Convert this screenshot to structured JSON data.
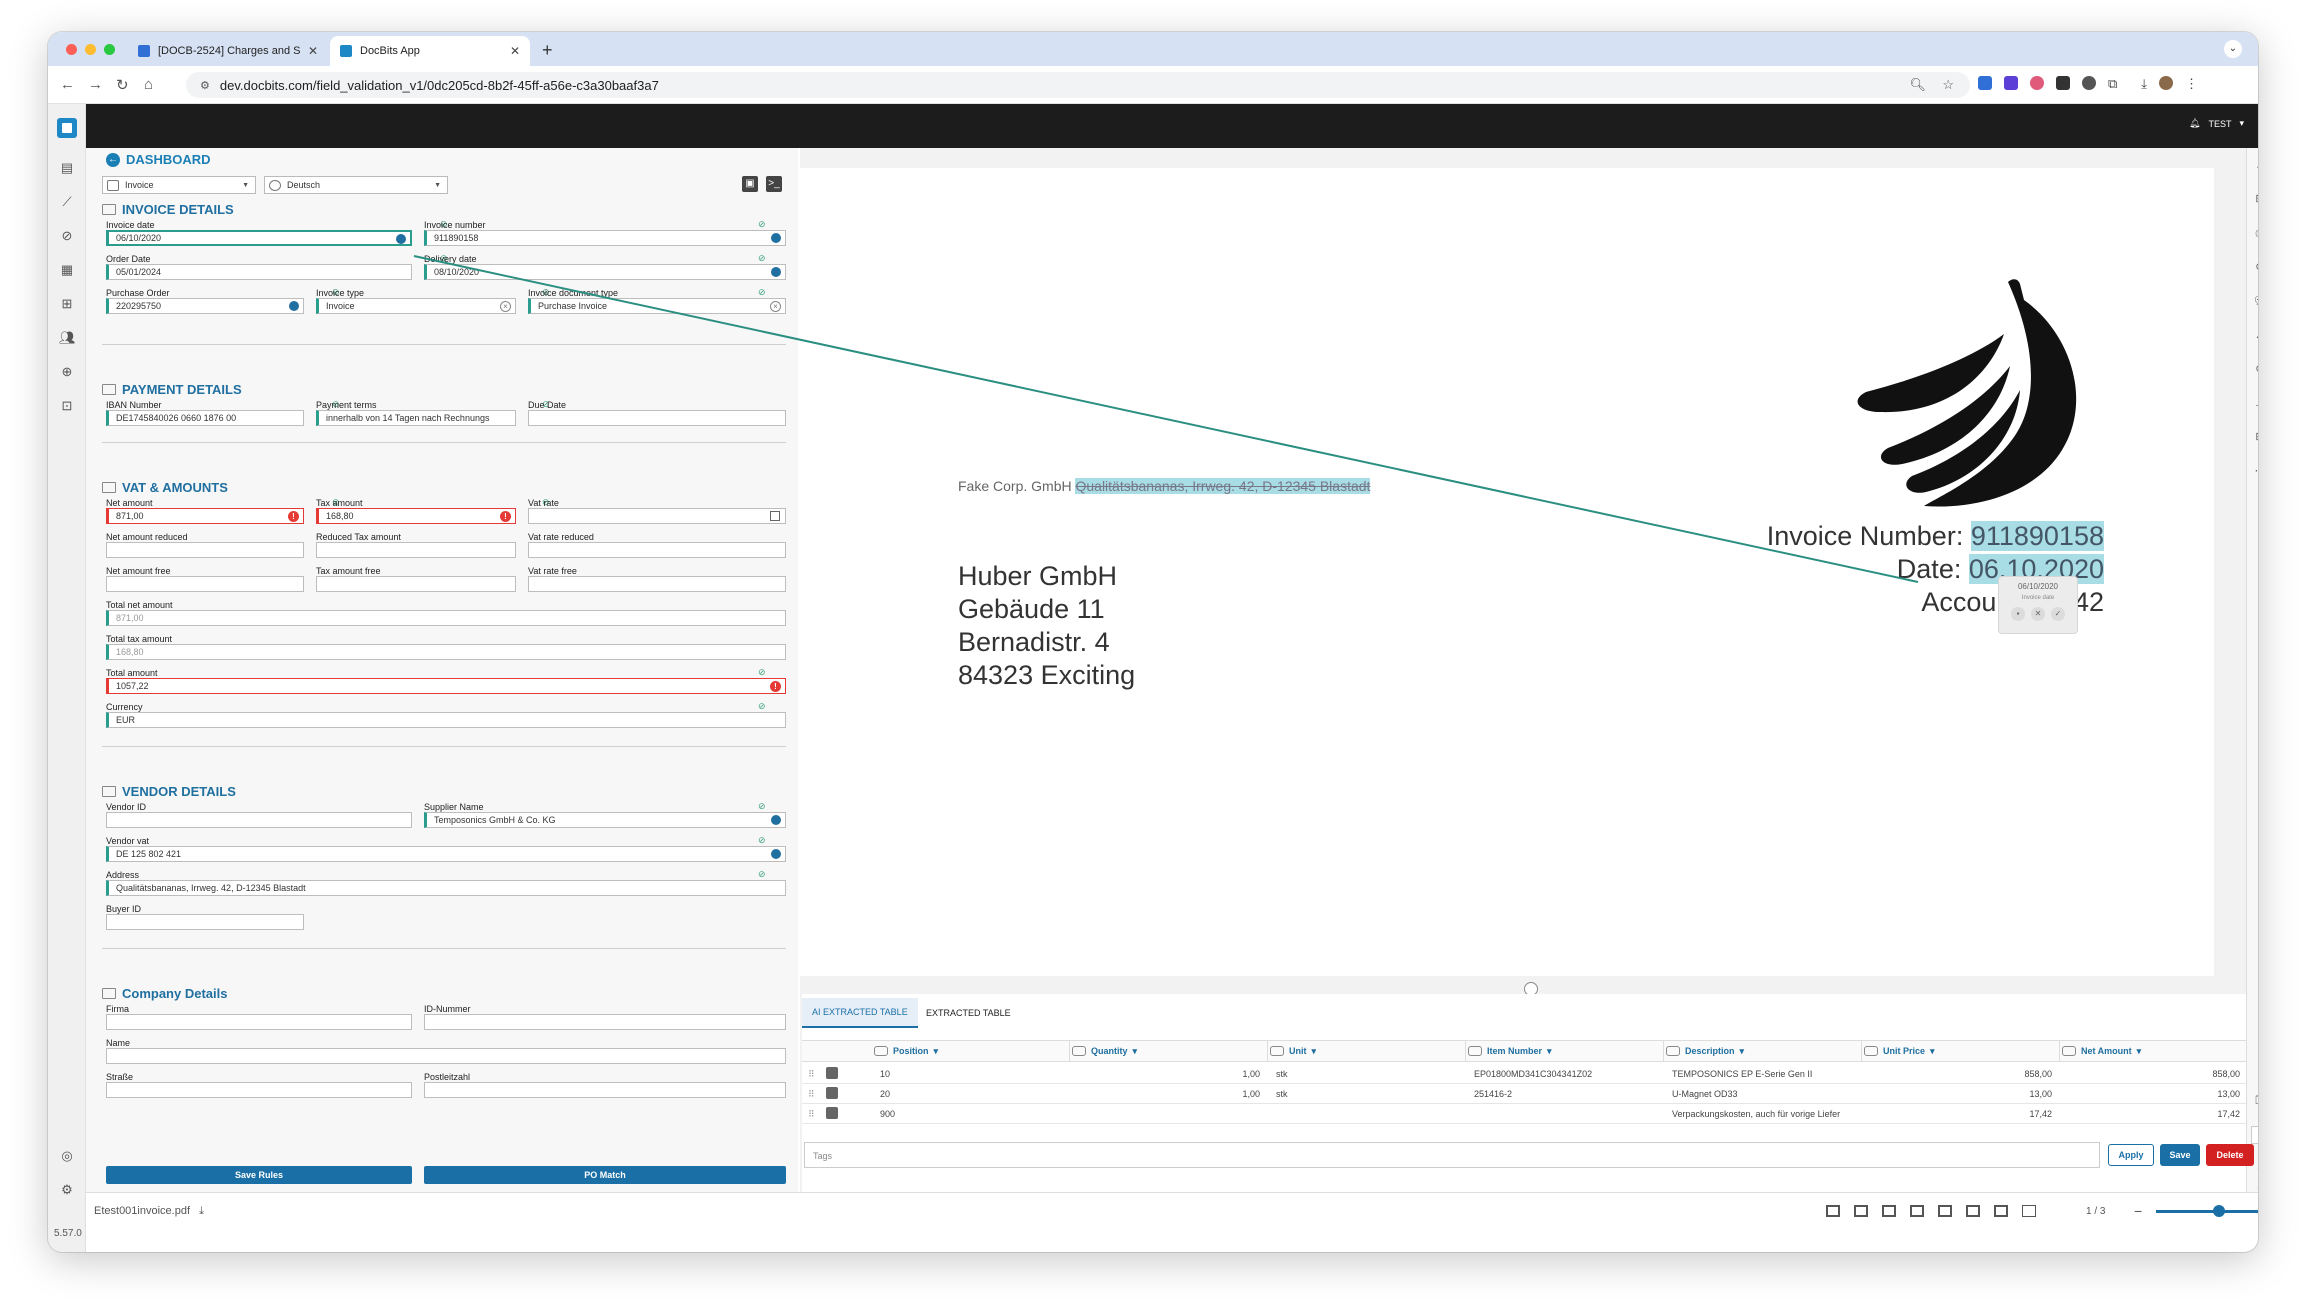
{
  "browser": {
    "tabs": [
      {
        "title": "[DOCB-2524] Charges and S",
        "close": "✕"
      },
      {
        "title": "DocBits App",
        "close": "✕"
      }
    ],
    "new_tab": "+",
    "url": "dev.docbits.com/field_validation_v1/0dc205cd-8b2f-45ff-a56e-c3a30baaf3a7"
  },
  "app": {
    "user": "TEST",
    "dashboard": "DASHBOARD",
    "doc_type": "Invoice",
    "language": "Deutsch",
    "version": "5.57.0"
  },
  "invoice_details": {
    "title": "INVOICE DETAILS",
    "invoice_date": {
      "label": "Invoice date",
      "value": "06/10/2020"
    },
    "invoice_number": {
      "label": "Invoice number",
      "value": "911890158"
    },
    "order_date": {
      "label": "Order Date",
      "value": "05/01/2024"
    },
    "delivery_date": {
      "label": "Delivery date",
      "value": "08/10/2020"
    },
    "purchase_order": {
      "label": "Purchase Order",
      "value": "220295750"
    },
    "invoice_type": {
      "label": "Invoice type",
      "value": "Invoice"
    },
    "invoice_document_type": {
      "label": "Invoice document type",
      "value": "Purchase Invoice"
    }
  },
  "payment_details": {
    "title": "PAYMENT DETAILS",
    "iban": {
      "label": "IBAN Number",
      "value": "DE1745840026 0660 1876 00"
    },
    "payment_terms": {
      "label": "Payment terms",
      "value": "innerhalb von 14 Tagen nach Rechnungs"
    },
    "due_date": {
      "label": "Due Date",
      "value": ""
    }
  },
  "vat_amounts": {
    "title": "VAT & AMOUNTS",
    "net_amount": {
      "label": "Net amount",
      "value": "871,00"
    },
    "tax_amount": {
      "label": "Tax amount",
      "value": "168,80"
    },
    "vat_rate": {
      "label": "Vat rate",
      "value": ""
    },
    "net_amount_reduced": {
      "label": "Net amount reduced",
      "value": ""
    },
    "reduced_tax_amount": {
      "label": "Reduced Tax amount",
      "value": ""
    },
    "vat_rate_reduced": {
      "label": "Vat rate reduced",
      "value": ""
    },
    "net_amount_free": {
      "label": "Net amount free",
      "value": ""
    },
    "tax_amount_free": {
      "label": "Tax amount free",
      "value": ""
    },
    "vat_rate_free": {
      "label": "Vat rate free",
      "value": ""
    },
    "total_net_amount": {
      "label": "Total net amount",
      "value": "871,00"
    },
    "total_tax_amount": {
      "label": "Total tax amount",
      "value": "168,80"
    },
    "total_amount": {
      "label": "Total amount",
      "value": "1057,22"
    },
    "currency": {
      "label": "Currency",
      "value": "EUR"
    }
  },
  "vendor_details": {
    "title": "VENDOR DETAILS",
    "vendor_id": {
      "label": "Vendor ID",
      "value": ""
    },
    "supplier_name": {
      "label": "Supplier Name",
      "value": "Temposonics GmbH & Co. KG"
    },
    "vendor_vat": {
      "label": "Vendor vat",
      "value": "DE 125 802 421"
    },
    "address": {
      "label": "Address",
      "value": "Qualitätsbananas, Irrweg. 42, D-12345 Blastadt"
    },
    "buyer_id": {
      "label": "Buyer ID",
      "value": ""
    }
  },
  "company_details": {
    "title": "Company Details",
    "firma": {
      "label": "Firma",
      "value": ""
    },
    "id_nummer": {
      "label": "ID-Nummer",
      "value": ""
    },
    "name": {
      "label": "Name",
      "value": ""
    },
    "strasse": {
      "label": "Straße",
      "value": ""
    },
    "postleitzahl": {
      "label": "Postleitzahl",
      "value": ""
    }
  },
  "buttons": {
    "save_rules": "Save Rules",
    "po_match": "PO Match"
  },
  "document": {
    "sender_prefix": "Fake Corp. GmbH",
    "sender_highlight": "Qualitätsbananas, Irrweg. 42, D-12345 Blastadt",
    "recipient": [
      "Huber GmbH",
      "Gebäude 11",
      "Bernadistr. 4",
      "84323 Exciting"
    ],
    "invoice_number_label": "Invoice Number:",
    "invoice_number_value": "911890158",
    "date_label": "Date:",
    "date_value": "06.10.2020",
    "account_label": "Account:",
    "account_value": "42",
    "popup_value": "06/10/2020",
    "popup_field": "Invoice date"
  },
  "table": {
    "tabs": [
      "AI EXTRACTED TABLE",
      "EXTRACTED TABLE"
    ],
    "columns": [
      "Position",
      "Quantity",
      "Unit",
      "Item Number",
      "Description",
      "Unit Price",
      "Net Amount"
    ],
    "rows": [
      {
        "position": "10",
        "quantity": "1,00",
        "unit": "stk",
        "item": "EP01800MD341C304341Z02",
        "description": "TEMPOSONICS EP E-Serie Gen II",
        "unit_price": "858,00",
        "net": "858,00"
      },
      {
        "position": "20",
        "quantity": "1,00",
        "unit": "stk",
        "item": "251416-2",
        "description": "U-Magnet OD33",
        "unit_price": "13,00",
        "net": "13,00"
      },
      {
        "position": "900",
        "quantity": "",
        "unit": "",
        "item": "",
        "description": "Verpackungskosten, auch für vorige Liefer",
        "unit_price": "17,42",
        "net": "17,42"
      }
    ],
    "tags_placeholder": "Tags",
    "apply": "Apply",
    "save": "Save",
    "delete": "Delete"
  },
  "footer": {
    "filename": "Etest001invoice.pdf",
    "page_counter": "1 / 3",
    "minus": "−",
    "plus": "+",
    "zoom_fraction": 0.6
  },
  "right_rail": {
    "page_current": "1",
    "page_total": "3"
  },
  "colors": {
    "accent": "#1a70a6",
    "teal": "#2a9d8f",
    "error": "#e53935",
    "dark_bar": "#1c1c1c"
  }
}
